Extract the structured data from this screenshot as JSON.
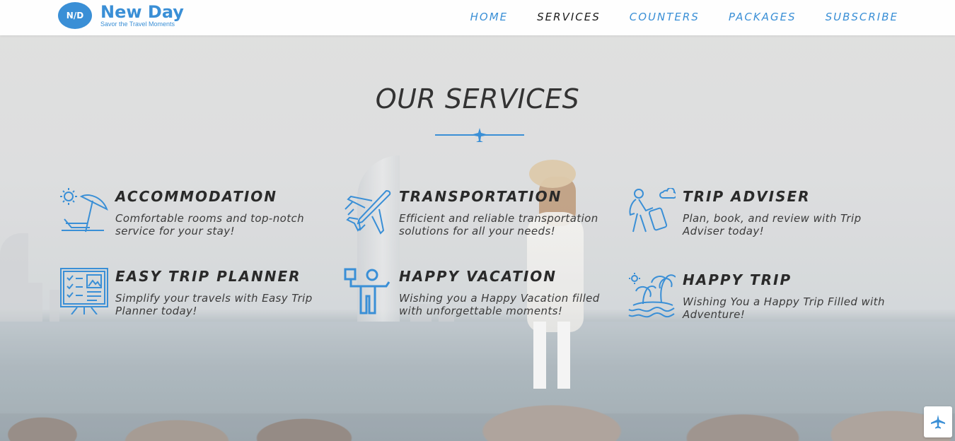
{
  "brand": {
    "logo_initials": "N/D",
    "name": "New Day",
    "tagline": "Savor the Travel Moments",
    "accent_color": "#3a8fd6"
  },
  "nav": {
    "items": [
      {
        "label": "HOME",
        "active": false
      },
      {
        "label": "SERVICES",
        "active": true
      },
      {
        "label": "COUNTERS",
        "active": false
      },
      {
        "label": "PACKAGES",
        "active": false
      },
      {
        "label": "SUBSCRIBE",
        "active": false
      }
    ]
  },
  "section": {
    "title": "OUR SERVICES",
    "divider_icon": "airplane-icon"
  },
  "services": [
    {
      "title": "ACCOMMODATION",
      "description": "Comfortable rooms and top-notch service for your stay!",
      "icon": "beach-umbrella-icon"
    },
    {
      "title": "TRANSPORTATION",
      "description": "Efficient and reliable transportation solutions for all your needs!",
      "icon": "airplane-icon"
    },
    {
      "title": "TRIP ADVISER",
      "description": "Plan, book, and review with Trip Adviser today!",
      "icon": "traveler-luggage-icon"
    },
    {
      "title": "EASY TRIP PLANNER",
      "description": "Simplify your travels with Easy Trip Planner today!",
      "icon": "planner-board-icon"
    },
    {
      "title": "HAPPY VACATION",
      "description": "Wishing you a Happy Vacation filled with unforgettable moments!",
      "icon": "happy-person-icon"
    },
    {
      "title": "HAPPY TRIP",
      "description": "Wishing You a Happy Trip Filled with Adventure!",
      "icon": "palm-island-icon"
    }
  ],
  "scroll_top": {
    "icon": "airplane-up-icon"
  }
}
